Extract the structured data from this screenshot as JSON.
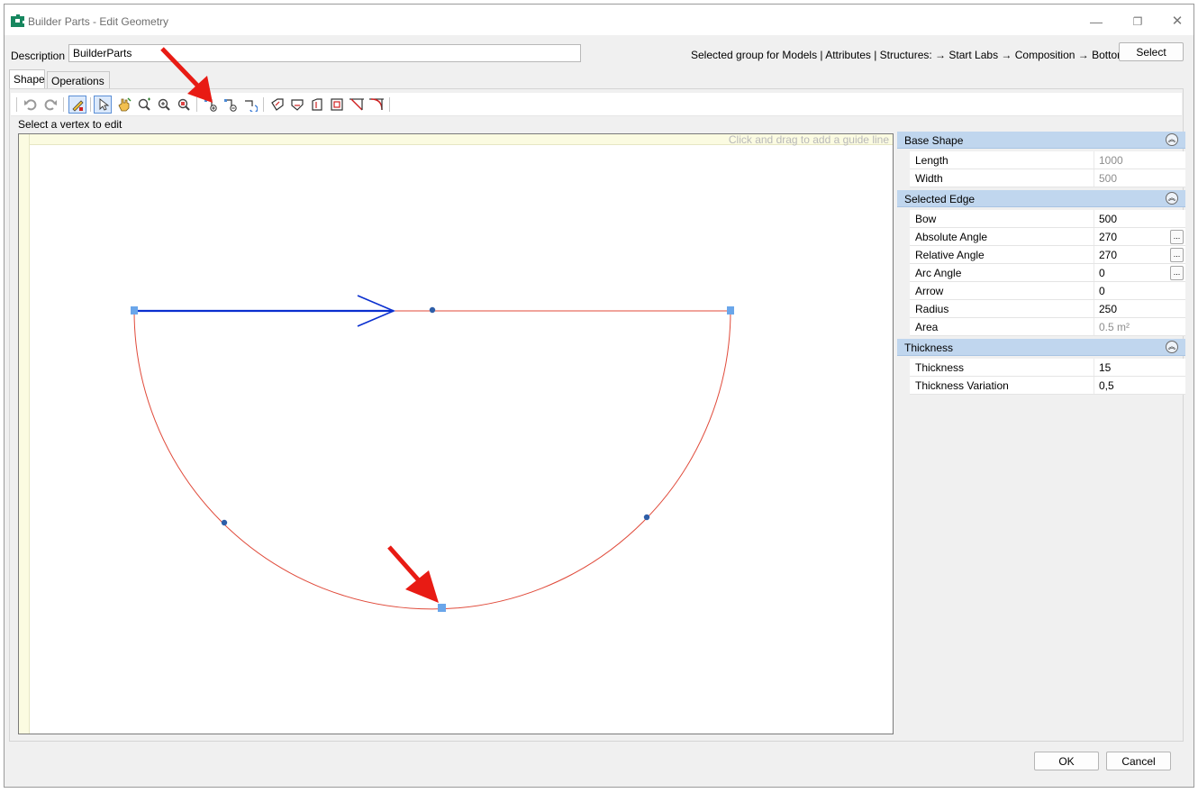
{
  "window": {
    "title": "Builder Parts - Edit Geometry",
    "controls": {
      "minimize": "—",
      "maximize": "❐",
      "close": "✕"
    }
  },
  "header": {
    "description_label": "Description",
    "description_value": "BuilderParts",
    "group_path": "Selected group for Models | Attributes | Structures:  → Start Labs → Composition → Bottoms",
    "select_label": "Select"
  },
  "tabs": [
    {
      "label": "Shape",
      "active": true
    },
    {
      "label": "Operations",
      "active": false
    }
  ],
  "toolbar": {
    "icons": [
      "undo-icon",
      "redo-icon",
      "edit-vertex-icon",
      "pointer-icon",
      "pan-hand-icon",
      "zoom-icon",
      "zoom-in-icon",
      "zoom-extents-icon",
      "add-vertex-icon",
      "remove-vertex-icon",
      "rotate-shape-icon",
      "shape-corner-1-icon",
      "shape-corner-2-icon",
      "shape-corner-3-icon",
      "shape-inset-icon",
      "chamfer-icon",
      "fillet-icon"
    ]
  },
  "status_text": "Select a vertex to edit",
  "canvas": {
    "guide_hint": "Click and drag to add a guide line",
    "colors": {
      "edge": "#e04a3a",
      "selected_edge": "#0a2fcf",
      "vertex": "#6aa6ea",
      "midpoint": "#2e5ea8",
      "arrow_annotation": "#e81b14"
    }
  },
  "properties": {
    "base_shape": {
      "title": "Base Shape",
      "rows": [
        {
          "name": "Length",
          "value": "1000"
        },
        {
          "name": "Width",
          "value": "500"
        }
      ]
    },
    "selected_edge": {
      "title": "Selected Edge",
      "rows": [
        {
          "name": "Bow",
          "value": "500"
        },
        {
          "name": "Absolute Angle",
          "value": "270"
        },
        {
          "name": "Relative Angle",
          "value": "270"
        },
        {
          "name": "Arc Angle",
          "value": "0"
        },
        {
          "name": "Arrow",
          "value": "0"
        },
        {
          "name": "Radius",
          "value": "250"
        },
        {
          "name": "Area",
          "value": "0.5 m²"
        }
      ]
    },
    "thickness": {
      "title": "Thickness",
      "rows": [
        {
          "name": "Thickness",
          "value": "15"
        },
        {
          "name": "Thickness Variation",
          "value": "0,5"
        }
      ]
    },
    "ellipsis": "..."
  },
  "footer": {
    "ok_label": "OK",
    "cancel_label": "Cancel"
  }
}
